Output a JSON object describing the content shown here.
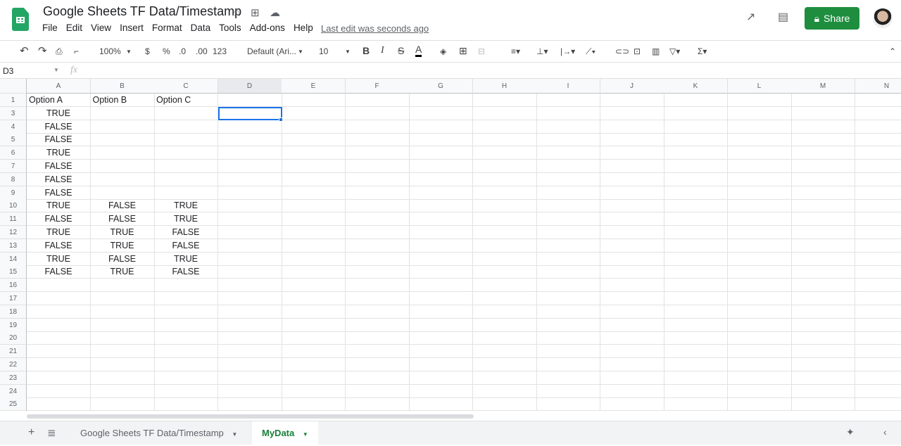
{
  "doc": {
    "title": "Google Sheets TF Data/Timestamp",
    "last_edit": "Last edit was seconds ago",
    "share_label": "Share"
  },
  "menu": [
    "File",
    "Edit",
    "View",
    "Insert",
    "Format",
    "Data",
    "Tools",
    "Add-ons",
    "Help"
  ],
  "toolbar": {
    "zoom": "100%",
    "currency": "$",
    "percent": "%",
    "dec_decrease": ".0",
    "dec_increase": ".00",
    "more_formats": "123",
    "font": "Default (Ari...",
    "font_size": "10"
  },
  "formula_bar": {
    "name_box": "D3",
    "fx": "fx",
    "value": ""
  },
  "columns": [
    "A",
    "B",
    "C",
    "D",
    "E",
    "F",
    "G",
    "H",
    "I",
    "J",
    "K",
    "L",
    "M",
    "N"
  ],
  "row_numbers": [
    1,
    3,
    4,
    5,
    6,
    7,
    8,
    9,
    10,
    11,
    12,
    13,
    14,
    15,
    16,
    17,
    18,
    19,
    20,
    21,
    22,
    23,
    24,
    25
  ],
  "header_row": [
    "Option A",
    "Option B",
    "Option C"
  ],
  "rows": [
    [
      "TRUE",
      "",
      ""
    ],
    [
      "FALSE",
      "",
      ""
    ],
    [
      "FALSE",
      "",
      ""
    ],
    [
      "TRUE",
      "",
      ""
    ],
    [
      "FALSE",
      "",
      ""
    ],
    [
      "FALSE",
      "",
      ""
    ],
    [
      "FALSE",
      "",
      ""
    ],
    [
      "TRUE",
      "FALSE",
      "TRUE"
    ],
    [
      "FALSE",
      "FALSE",
      "TRUE"
    ],
    [
      "TRUE",
      "TRUE",
      "FALSE"
    ],
    [
      "FALSE",
      "TRUE",
      "FALSE"
    ],
    [
      "TRUE",
      "FALSE",
      "TRUE"
    ],
    [
      "FALSE",
      "TRUE",
      "FALSE"
    ]
  ],
  "selected_cell": "D3",
  "sheets": [
    {
      "label": "Google Sheets TF Data/Timestamp",
      "active": false
    },
    {
      "label": "MyData",
      "active": true
    }
  ],
  "colors": {
    "brand": "#23a566",
    "share": "#1e8e3e",
    "selection": "#1a73e8"
  }
}
